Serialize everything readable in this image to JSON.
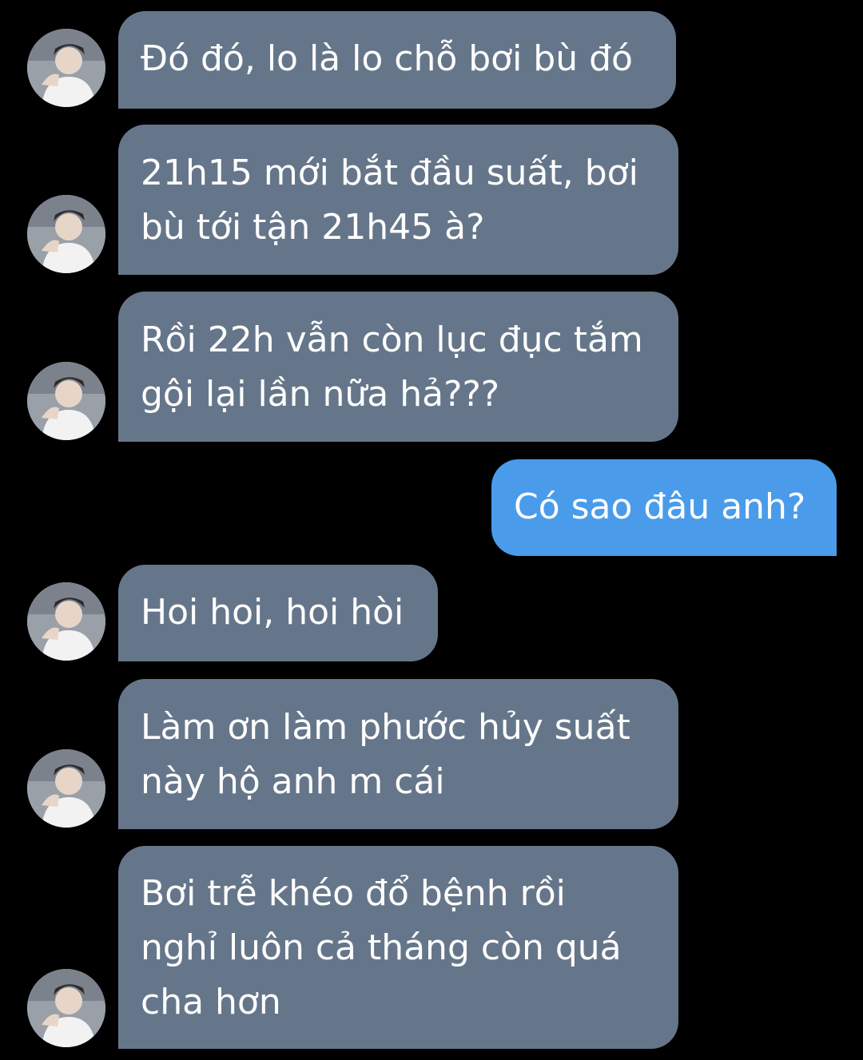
{
  "conversation": {
    "messages": [
      {
        "direction": "incoming",
        "text": "Đó đó, lo là lo chỗ bơi bù đó"
      },
      {
        "direction": "incoming",
        "text": "21h15 mới bắt đầu suất, bơi\nbù tới tận 21h45 à?"
      },
      {
        "direction": "incoming",
        "text": "Rồi 22h vẫn còn lục đục tắm\ngội lại lần nữa hả???"
      },
      {
        "direction": "outgoing",
        "text": "Có sao đâu anh?"
      },
      {
        "direction": "incoming",
        "text": "Hoi hoi, hoi hòi"
      },
      {
        "direction": "incoming",
        "text": "Làm ơn làm phước hủy suất\nnày hộ anh m cái"
      },
      {
        "direction": "incoming",
        "text": "Bơi trễ khéo đổ bệnh rồi\nnghỉ luôn cả tháng còn quá\ncha hơn"
      }
    ]
  },
  "colors": {
    "background": "#000000",
    "incoming_bubble": "#66768a",
    "outgoing_bubble": "#4a9ceb",
    "text": "#ffffff"
  },
  "icons": {
    "contact_avatar": "avatar-photo"
  }
}
